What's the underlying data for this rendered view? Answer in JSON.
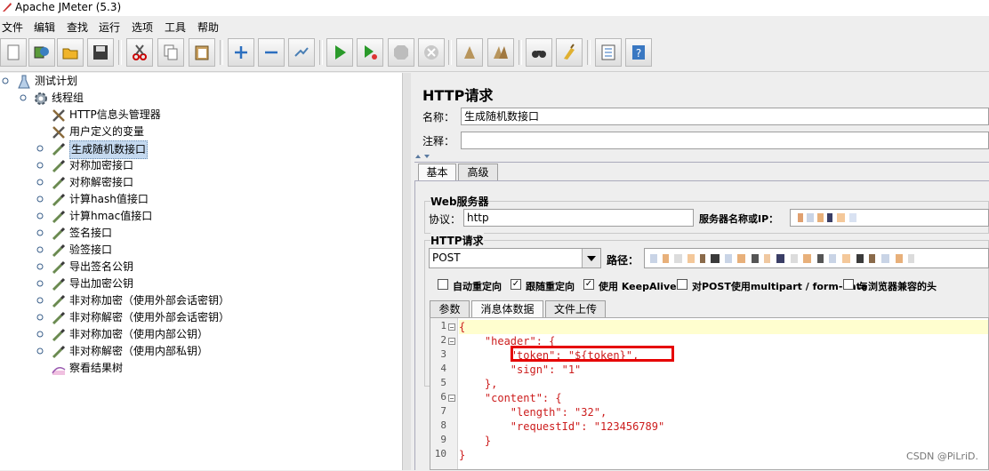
{
  "window": {
    "title": "Apache JMeter (5.3)"
  },
  "menu": [
    "文件",
    "编辑",
    "查找",
    "运行",
    "选项",
    "工具",
    "帮助"
  ],
  "toolbar": {
    "buttons": [
      "new-icon",
      "templates-icon",
      "open-icon",
      "save-icon",
      "cut-icon",
      "copy-icon",
      "paste-icon",
      "expand-icon",
      "collapse-icon",
      "toggle-icon",
      "start-icon",
      "start-no-pause-icon",
      "stop-icon",
      "shutdown-icon",
      "clear-icon",
      "clear-all-icon",
      "search-icon",
      "reset-search-icon",
      "function-helper-icon",
      "help-icon"
    ]
  },
  "tree": {
    "test_plan": "测试计划",
    "thread_group": "线程组",
    "items": [
      "HTTP信息头管理器",
      "用户定义的变量",
      "生成随机数接口",
      "对称加密接口",
      "对称解密接口",
      "计算hash值接口",
      "计算hmac值接口",
      "签名接口",
      "验签接口",
      "导出签名公钥",
      "导出加密公钥",
      "非对称加密（使用外部会话密钥）",
      "非对称解密（使用外部会话密钥）",
      "非对称加密（使用内部公钥）",
      "非对称解密（使用内部私钥）",
      "察看结果树"
    ],
    "selected_index": 2
  },
  "panel": {
    "title": "HTTP请求",
    "name_label": "名称：",
    "name_value": "生成随机数接口",
    "comment_label": "注释：",
    "comment_value": "",
    "tabs": [
      "基本",
      "高级"
    ],
    "web_server": {
      "title": "Web服务器",
      "protocol_label": "协议：",
      "protocol_value": "http",
      "server_label": "服务器名称或IP："
    },
    "http_request": {
      "title": "HTTP请求",
      "method": "POST",
      "path_label": "路径："
    },
    "checkboxes": [
      {
        "label": "自动重定向",
        "checked": false
      },
      {
        "label": "跟随重定向",
        "checked": true
      },
      {
        "label": "使用 KeepAlive",
        "checked": true
      },
      {
        "label": "对POST使用multipart / form-data",
        "checked": false
      },
      {
        "label": "与浏览器兼容的头",
        "checked": false
      }
    ],
    "sub_tabs": [
      "参数",
      "消息体数据",
      "文件上传"
    ],
    "body_lines": [
      "{",
      "    \"header\": {",
      "        \"token\": \"${token}\",",
      "        \"sign\": \"1\"",
      "    },",
      "    \"content\": {",
      "        \"length\": \"32\",",
      "        \"requestId\": \"123456789\"",
      "    }",
      "}"
    ],
    "line_numbers": [
      "1",
      "2",
      "3",
      "4",
      "5",
      "6",
      "7",
      "8",
      "9",
      "10"
    ]
  },
  "watermark": "CSDN @PiLriD.",
  "colors": {
    "selection": "#c5d9ef",
    "code_text": "#cc1c1c",
    "highlight_box": "#e60000",
    "current_line": "#fffecf"
  }
}
